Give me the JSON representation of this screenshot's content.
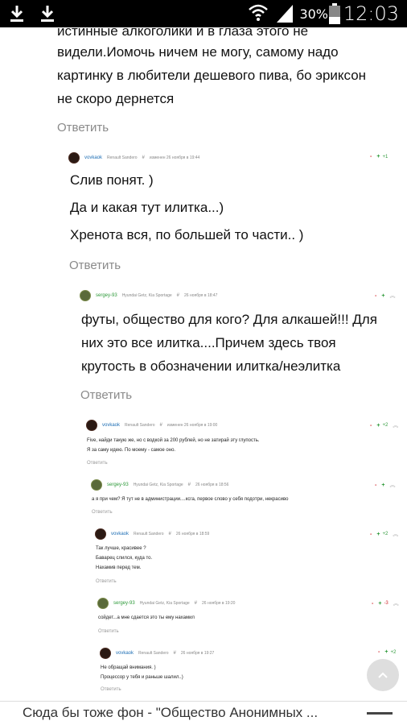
{
  "status_bar": {
    "battery": "30%",
    "time": "12:03"
  },
  "top_partial": {
    "lines": [
      "истинные алкоголики и в глаза этого не",
      "видели.Иомочь ничем не могу, самому надо",
      "картинку в любители дешевого пива, бо эриксон",
      "не скоро дернется"
    ],
    "reply": "Ответить"
  },
  "comments": [
    {
      "author": "vovkaok",
      "car": "Renault Sandero",
      "hash": "#",
      "date": "изменен 26 ноября в 19:44",
      "rating": {
        "minus": "-",
        "plus": "+",
        "value": "+1"
      },
      "lines": [
        "Слив понят. )",
        "Да и какая тут илитка...)",
        "Хренота вся, по большей то части.. )"
      ],
      "reply": "Ответить"
    },
    {
      "author": "sergey-93",
      "car": "Hyundai Getz, Kia Sportage",
      "hash": "#",
      "date": "26 ноября в 18:47",
      "rating": {
        "minus": "-",
        "plus": "+",
        "value": ""
      },
      "lines": [
        "футы, общество для кого? Для алкашей!!! Для",
        "них это все илитка....Причем здесь твоя",
        "крутость в обозначении илитка/неэлитка"
      ],
      "reply": "Ответить"
    },
    {
      "author": "vovkaok",
      "car": "Renault Sandero",
      "hash": "#",
      "date": "изменен 26 ноября в 19:00",
      "rating": {
        "minus": "-",
        "plus": "+",
        "value": "+2"
      },
      "lines": [
        "Five, найди такую же, но с водкой за 200 рублей, но не затирай эту глупость.",
        "Я за саму идею. По моему - самое оно."
      ],
      "reply": "Ответить"
    },
    {
      "author": "sergey-93",
      "car": "Hyundai Getz, Kia Sportage",
      "hash": "#",
      "date": "26 ноября в 18:56",
      "rating": {
        "minus": "-",
        "plus": "+",
        "value": ""
      },
      "lines": [
        "а я при чем? Я тут не в администрации....ксга, первое слово у себя подотри, некрасиво"
      ],
      "reply": "Ответить"
    },
    {
      "author": "vovkaok",
      "car": "Renault Sandero",
      "hash": "#",
      "date": "26 ноября в 18:59",
      "rating": {
        "minus": "-",
        "plus": "+",
        "value": "+2"
      },
      "lines": [
        "Так лучше, красивее ?",
        "Баварец слился, куда то.",
        "Нахамив перед тем."
      ],
      "reply": "Ответить"
    },
    {
      "author": "sergey-93",
      "car": "Hyundai Getz, Kia Sportage",
      "hash": "#",
      "date": "26 ноября в 19:20",
      "rating": {
        "minus": "-",
        "plus": "+",
        "value": "-3"
      },
      "lines": [
        "сойдет...а мне сдается это ты ему нахамил"
      ],
      "reply": "Ответить"
    },
    {
      "author": "vovkaok",
      "car": "Renault Sandero",
      "hash": "#",
      "date": "26 ноября в 19:27",
      "rating": {
        "minus": "-",
        "plus": "+",
        "value": "+2"
      },
      "lines": [
        "Не обращай внимания. )",
        "Процессор у тебя и раньше шалил..)"
      ],
      "reply": "Ответить"
    }
  ],
  "bottom_bar": {
    "title": "Сюда бы тоже фон - \"Общество Анонимных ..."
  }
}
